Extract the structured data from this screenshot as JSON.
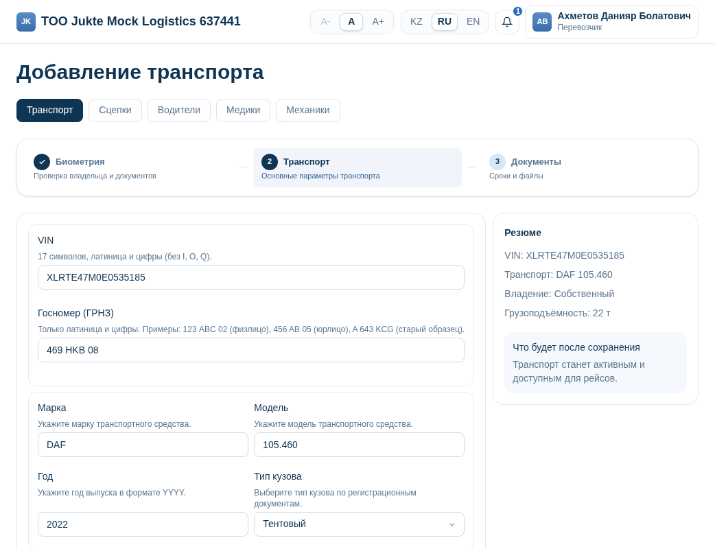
{
  "header": {
    "logo": "JK",
    "company": "TOO Jukte Mock Logistics 637441",
    "font_sizes": [
      {
        "label": "A-",
        "selected": false,
        "disabled": true
      },
      {
        "label": "A",
        "selected": true,
        "disabled": false
      },
      {
        "label": "A+",
        "selected": false,
        "disabled": false
      }
    ],
    "languages": [
      {
        "label": "KZ",
        "selected": false
      },
      {
        "label": "RU",
        "selected": true
      },
      {
        "label": "EN",
        "selected": false
      }
    ],
    "notifications": {
      "count": "1"
    },
    "user": {
      "initials": "AB",
      "name": "Ахметов Данияр Болатович",
      "role": "Перевозчик"
    }
  },
  "page_title": "Добавление транспорта",
  "tabs": [
    {
      "label": "Транспорт",
      "selected": true
    },
    {
      "label": "Сцепки",
      "selected": false
    },
    {
      "label": "Водители",
      "selected": false
    },
    {
      "label": "Медики",
      "selected": false
    },
    {
      "label": "Механики",
      "selected": false
    }
  ],
  "steps": [
    {
      "completed": true,
      "selected": false,
      "title": "Биометрия",
      "subtitle": "Проверка владельца и документов"
    },
    {
      "completed": false,
      "selected": true,
      "number": "2",
      "title": "Транспорт",
      "subtitle": "Основные параметры транспорта"
    },
    {
      "completed": false,
      "selected": false,
      "number": "3",
      "title": "Документы",
      "subtitle": "Сроки и файлы"
    }
  ],
  "form_sections": [
    {
      "kind": "stacked",
      "fields": [
        {
          "kind": "text",
          "label": "VIN",
          "hint": "17 символов, латиница и цифры (без I, O, Q).",
          "value": "XLRTE47M0E0535185"
        },
        {
          "kind": "text",
          "label": "Госномер (ГРНЗ)",
          "hint": "Только латиница и цифры. Примеры: 123 ABC 02 (физлицо), 456 AB 05 (юрлицо), A 643 KCG (старый образец).",
          "value": "469 HKB 08"
        }
      ]
    },
    {
      "kind": "grid",
      "fields": [
        {
          "kind": "text",
          "label": "Марка",
          "hint": "Укажите марку транспортного средства.",
          "value": "DAF"
        },
        {
          "kind": "text",
          "label": "Модель",
          "hint": "Укажите модель транспортного средства.",
          "value": "105.460"
        },
        {
          "kind": "text",
          "label": "Год",
          "hint": "Укажите год выпуска в формате YYYY.",
          "value": "2022"
        },
        {
          "kind": "select",
          "label": "Тип кузова",
          "hint": "Выберите тип кузова по регистрационным документам.",
          "value": "Тентовый"
        }
      ]
    }
  ],
  "summary": {
    "title": "Резюме",
    "lines": [
      "VIN: XLRTE47M0E0535185",
      "Транспорт: DAF 105.460",
      "Владение: Собственный",
      "Грузоподъёмность: 22 т"
    ],
    "note": {
      "title": "Что будет после сохранения",
      "text": "Транспорт станет активным и доступным для рейсов."
    }
  }
}
